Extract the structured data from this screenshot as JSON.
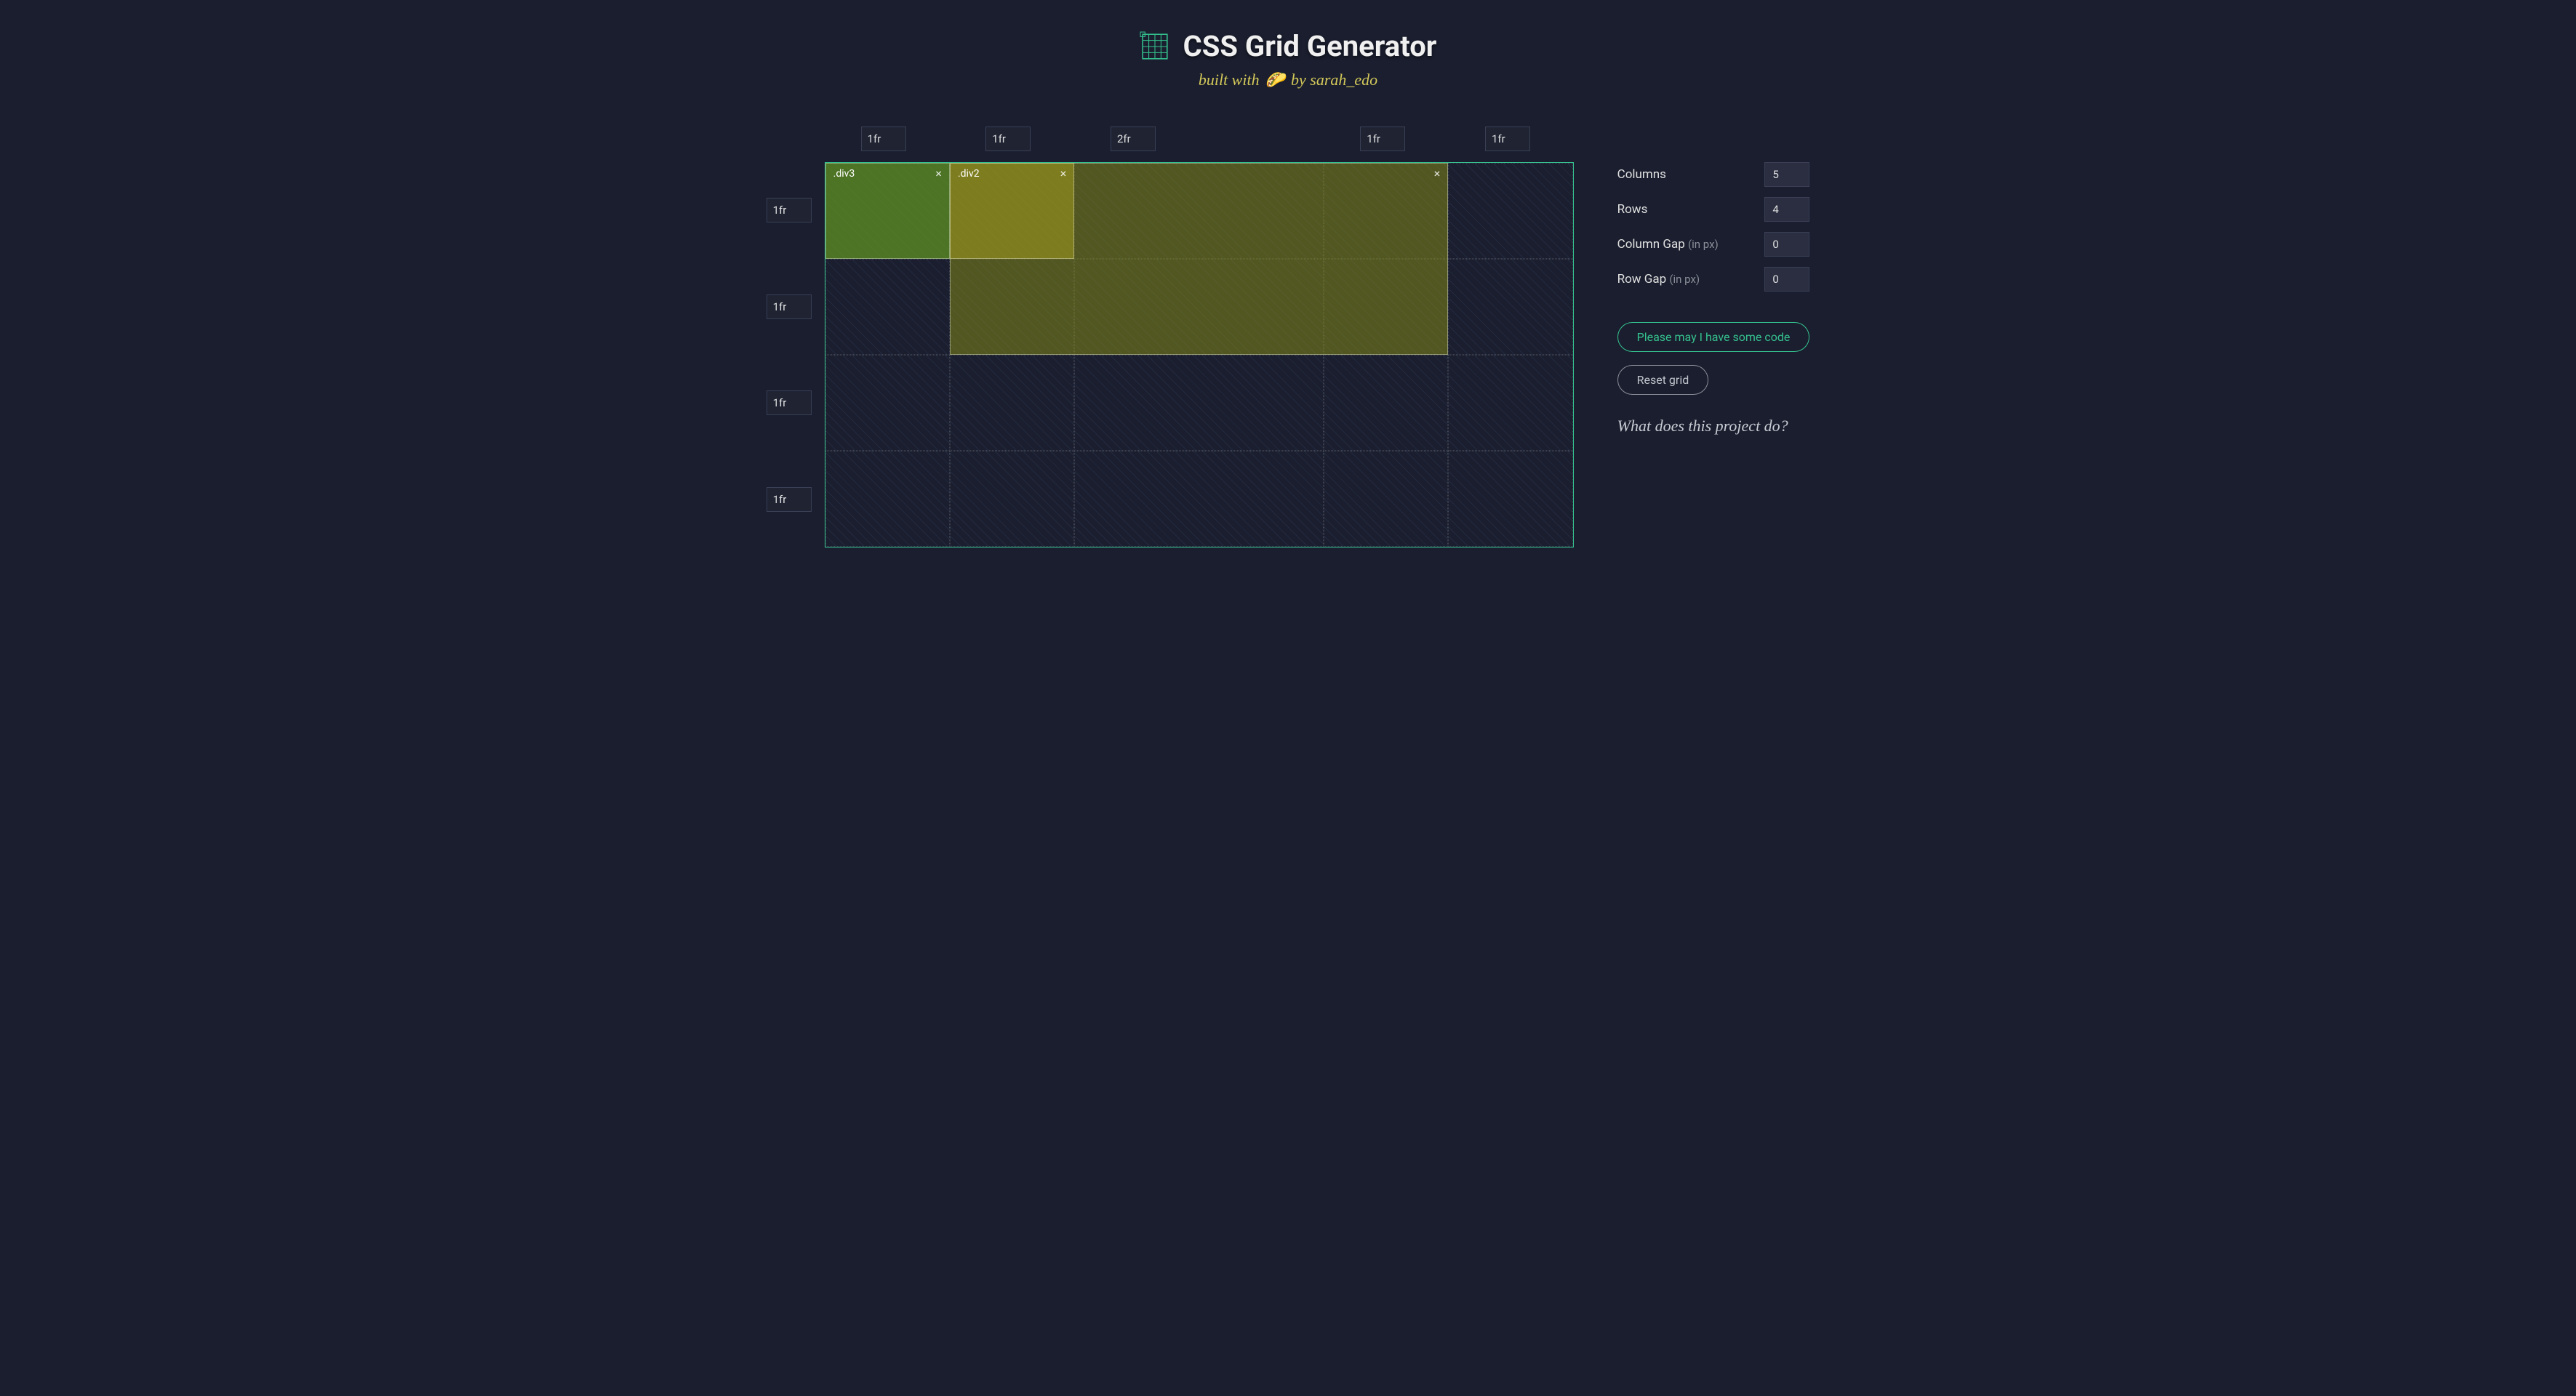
{
  "header": {
    "title": "CSS Grid Generator",
    "subtitle_prefix": "built with",
    "subtitle_emoji": "🌮",
    "subtitle_suffix": "by sarah_edo"
  },
  "columns": [
    "1fr",
    "1fr",
    "2fr",
    "1fr",
    "1fr"
  ],
  "rows": [
    "1fr",
    "1fr",
    "1fr",
    "1fr"
  ],
  "placed": [
    {
      "label": "",
      "col_start": 2,
      "col_end": 5,
      "row_start": 1,
      "row_end": 3,
      "style": "p1"
    },
    {
      "label": ".div2",
      "col_start": 2,
      "col_end": 3,
      "row_start": 1,
      "row_end": 2,
      "style": "p2"
    },
    {
      "label": ".div3",
      "col_start": 1,
      "col_end": 2,
      "row_start": 1,
      "row_end": 2,
      "style": "p3"
    }
  ],
  "sidebar": {
    "columns_label": "Columns",
    "columns_value": "5",
    "rows_label": "Rows",
    "rows_value": "4",
    "colgap_label": "Column Gap",
    "colgap_hint": "(in px)",
    "colgap_value": "0",
    "rowgap_label": "Row Gap",
    "rowgap_hint": "(in px)",
    "rowgap_value": "0",
    "code_btn": "Please may I have some code",
    "reset_btn": "Reset grid",
    "what_link": "What does this project do?"
  }
}
